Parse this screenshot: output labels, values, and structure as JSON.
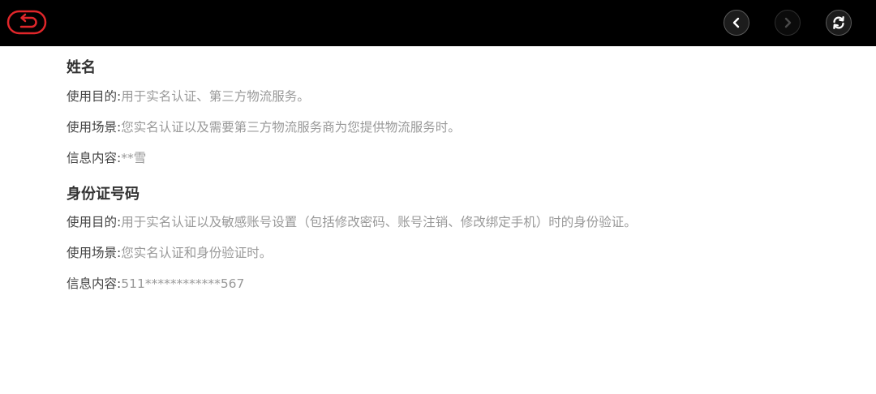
{
  "sections": [
    {
      "title": "姓名",
      "rows": [
        {
          "label": "使用目的:",
          "value": "用于实名认证、第三方物流服务。"
        },
        {
          "label": "使用场景:",
          "value": "您实名认证以及需要第三方物流服务商为您提供物流服务时。"
        },
        {
          "label": "信息内容:",
          "value": "**雪"
        }
      ]
    },
    {
      "title": "身份证号码",
      "rows": [
        {
          "label": "使用目的:",
          "value": "用于实名认证以及敏感账号设置（包括修改密码、账号注销、修改绑定手机）时的身份验证。"
        },
        {
          "label": "使用场景:",
          "value": "您实名认证和身份验证时。"
        },
        {
          "label": "信息内容:",
          "value": "511************567"
        }
      ]
    }
  ],
  "colors": {
    "topbar": "#000000",
    "back_accent": "#e0262a",
    "title_text": "#333333",
    "label_text": "#444444",
    "value_text": "#999999"
  },
  "icons": {
    "back": "back-arrow-icon",
    "prev": "chevron-left-icon",
    "next": "chevron-right-icon",
    "refresh": "refresh-icon"
  }
}
